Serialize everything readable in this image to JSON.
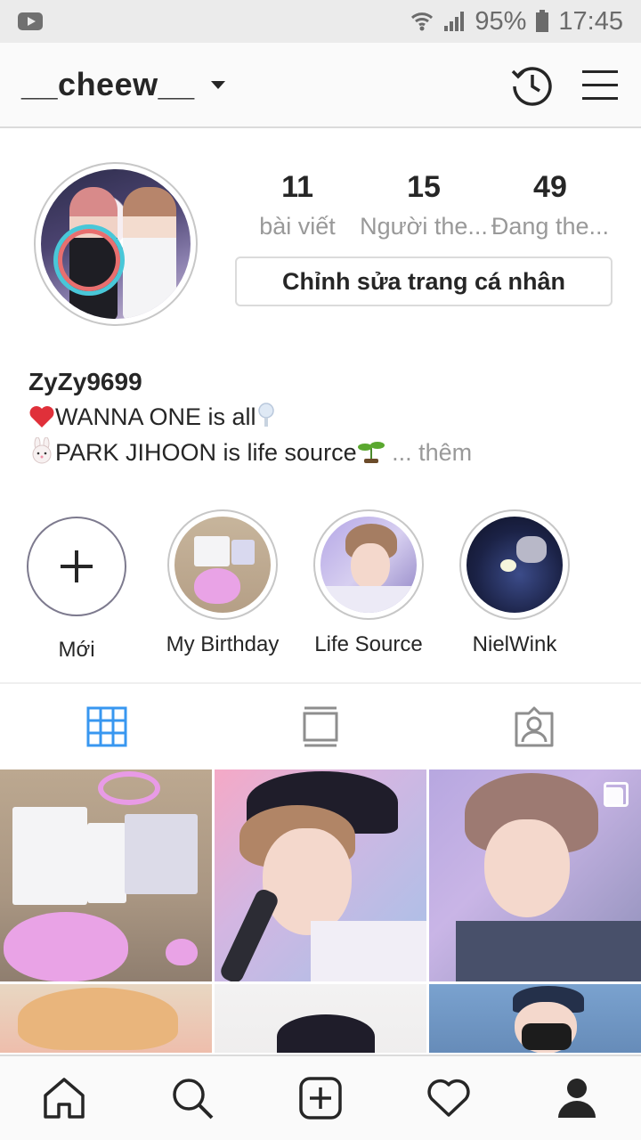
{
  "status_bar": {
    "battery": "95%",
    "time": "17:45"
  },
  "header": {
    "username": "__cheew__"
  },
  "profile": {
    "stats": [
      {
        "value": "11",
        "label": "bài viết"
      },
      {
        "value": "15",
        "label": "Người the..."
      },
      {
        "value": "49",
        "label": "Đang the..."
      }
    ],
    "edit_button": "Chỉnh sửa trang cá nhân",
    "display_name": "ZyZy9699",
    "bio_line1": "WANNA ONE is all",
    "bio_line2": "PARK JIHOON is life source",
    "bio_more": "... thêm"
  },
  "highlights": [
    {
      "label": "Mới"
    },
    {
      "label": "My Birthday"
    },
    {
      "label": "Life Source"
    },
    {
      "label": "NielWink"
    }
  ],
  "colors": {
    "active_tab": "#3897f0",
    "text": "#262626",
    "muted": "#999999",
    "border": "#dbdbdb"
  }
}
